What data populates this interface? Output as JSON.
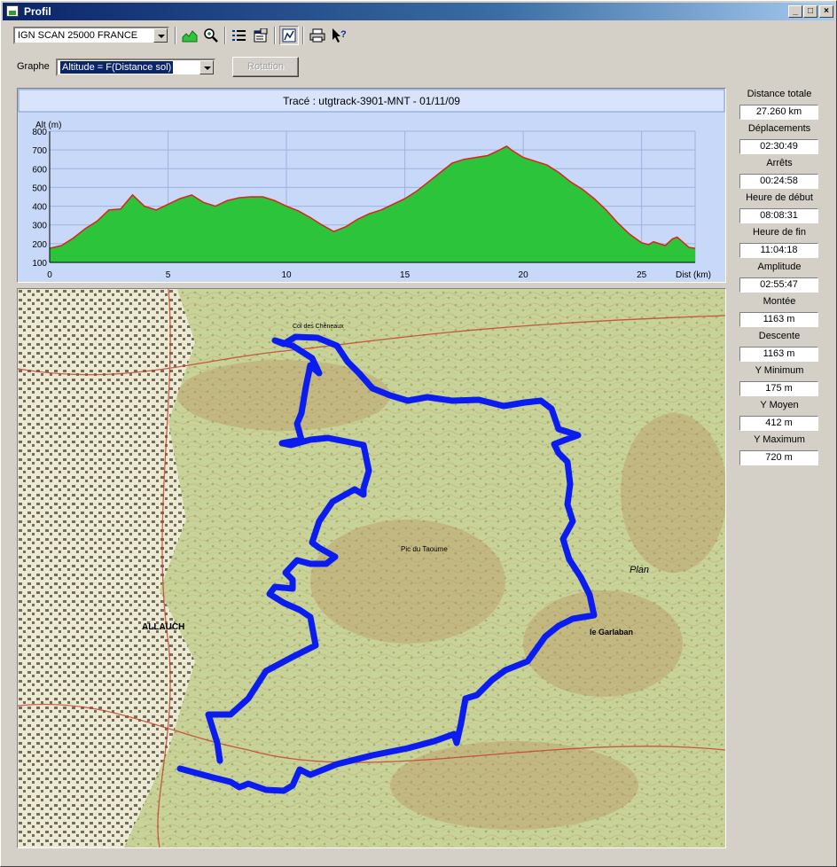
{
  "window": {
    "title": "Profil",
    "buttons": {
      "minimize": "_",
      "maximize": "□",
      "close": "×"
    }
  },
  "toolbar": {
    "map_source": "IGN SCAN 25000 FRANCE",
    "icons": [
      "profile-chart-icon",
      "zoom-icon",
      "list-icon",
      "properties-icon",
      "graph-mode-icon",
      "print-icon",
      "help-icon"
    ]
  },
  "graph": {
    "label": "Graphe",
    "mode": "Altitude = F(Distance sol)",
    "rotation_label": "Rotation"
  },
  "chart_data": {
    "type": "area",
    "title": "Tracé : utgtrack-3901-MNT - 01/11/09",
    "ylabel": "Alt (m)",
    "xlabel": "Dist (km)",
    "xlim": [
      0,
      27.26
    ],
    "ylim": [
      100,
      800
    ],
    "xticks": [
      0,
      5,
      10,
      15,
      20,
      25
    ],
    "yticks": [
      100,
      200,
      300,
      400,
      500,
      600,
      700,
      800
    ],
    "grid": true,
    "colors": {
      "fill": "#2bc43b",
      "line": "#e02020",
      "background": "#c8d8f8",
      "grid": "#9db3e0"
    },
    "x": [
      0,
      0.5,
      1,
      1.5,
      2,
      2.5,
      3,
      3.5,
      4,
      4.5,
      5,
      5.5,
      6,
      6.5,
      7,
      7.5,
      8,
      8.5,
      9,
      9.5,
      10,
      10.5,
      11,
      11.5,
      12,
      12.5,
      13,
      13.5,
      14,
      14.5,
      15,
      15.5,
      16,
      16.5,
      17,
      17.5,
      18,
      18.5,
      19,
      19.3,
      19.5,
      20,
      20.5,
      21,
      21.5,
      22,
      22.5,
      23,
      23.5,
      24,
      24.5,
      25,
      25.3,
      25.5,
      26,
      26.3,
      26.5,
      27,
      27.26
    ],
    "y": [
      175,
      190,
      230,
      280,
      320,
      380,
      385,
      460,
      400,
      380,
      410,
      440,
      460,
      420,
      400,
      430,
      445,
      450,
      450,
      430,
      400,
      375,
      340,
      300,
      265,
      290,
      330,
      360,
      380,
      410,
      440,
      480,
      530,
      580,
      630,
      650,
      660,
      670,
      700,
      720,
      700,
      660,
      640,
      620,
      580,
      530,
      490,
      440,
      380,
      310,
      250,
      205,
      195,
      210,
      190,
      225,
      235,
      180,
      175
    ]
  },
  "stats": [
    {
      "label": "Distance totale",
      "value": "27.260 km"
    },
    {
      "label": "Déplacements",
      "value": "02:30:49"
    },
    {
      "label": "Arrêts",
      "value": "00:24:58"
    },
    {
      "label": "Heure de début",
      "value": "08:08:31"
    },
    {
      "label": "Heure de fin",
      "value": "11:04:18"
    },
    {
      "label": "Amplitude",
      "value": "02:55:47"
    },
    {
      "label": "Montée",
      "value": "1163 m"
    },
    {
      "label": "Descente",
      "value": "1163 m"
    },
    {
      "label": "Y Minimum",
      "value": "175 m"
    },
    {
      "label": "Y Moyen",
      "value": "412 m"
    },
    {
      "label": "Y Maximum",
      "value": "720 m"
    }
  ],
  "map": {
    "place_labels": [
      "ALLAUCH",
      "Pic du Taoume",
      "le Garlaban",
      "Col des Chêneaux",
      "Plan"
    ],
    "colors": {
      "track": "#0a1cf0",
      "terrain": "#e8dcb0",
      "forest": "#b9cf8e",
      "urban": "#f0eee0",
      "relief": "#c9a878"
    }
  }
}
